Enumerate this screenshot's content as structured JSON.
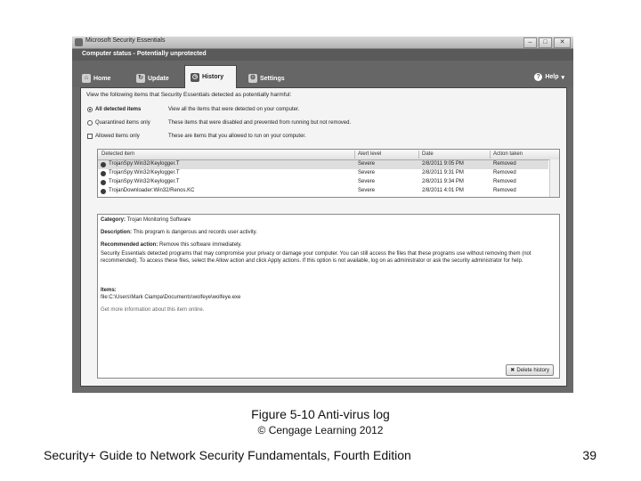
{
  "window": {
    "title": "Microsoft Security Essentials",
    "status": "Computer status - Potentially unprotected",
    "controls": {
      "minimize": "–",
      "maximize": "□",
      "close": "✕"
    }
  },
  "tabs": [
    {
      "label": "Home",
      "icon": "home-icon",
      "glyph": "⌂"
    },
    {
      "label": "Update",
      "icon": "update-icon",
      "glyph": "↻"
    },
    {
      "label": "History",
      "icon": "history-icon",
      "glyph": "◷",
      "active": true
    },
    {
      "label": "Settings",
      "icon": "gear-icon",
      "glyph": "⚙"
    }
  ],
  "help": {
    "label": "Help",
    "glyph": "?"
  },
  "history": {
    "intro": "View the following items that Security Essentials detected as potentially harmful:",
    "options": [
      {
        "label": "All detected items",
        "desc": "View all the items that were detected on your computer.",
        "selected": true
      },
      {
        "label": "Quarantined items only",
        "desc": "These items that were disabled and prevented from running but not removed.",
        "selected": false
      },
      {
        "label": "Allowed items only",
        "desc": "These are items that you allowed to run on your computer.",
        "selected": false
      }
    ],
    "columns": [
      "Detected item",
      "Alert level",
      "Date",
      "Action taken"
    ],
    "rows": [
      {
        "item": "TrojanSpy:Win32/Keylogger.T",
        "level": "Severe",
        "date": "2/8/2011 9:05 PM",
        "action": "Removed"
      },
      {
        "item": "TrojanSpy:Win32/Keylogger.T",
        "level": "Severe",
        "date": "2/8/2011 9:31 PM",
        "action": "Removed"
      },
      {
        "item": "TrojanSpy:Win32/Keylogger.T",
        "level": "Severe",
        "date": "2/8/2011 9:34 PM",
        "action": "Removed"
      },
      {
        "item": "TrojanDownloader:Win32/Renos.KC",
        "level": "Severe",
        "date": "2/8/2011 4:01 PM",
        "action": "Removed"
      }
    ],
    "details": {
      "category_label": "Category:",
      "category": "Trojan Monitoring Software",
      "description_label": "Description:",
      "description": "This program is dangerous and records user activity.",
      "recommendation_label": "Recommended action:",
      "recommendation": "Remove this software immediately.",
      "paragraph": "Security Essentials detected programs that may compromise your privacy or damage your computer. You can still access the files that these programs use without removing them (not recommended). To access these files, select the Allow action and click Apply actions. If this option is not available, log on as administrator or ask the security administrator for help.",
      "items_label": "Items:",
      "item_path": "file:C:\\Users\\Mark Ciampa\\Documents\\wolfeye\\wolfeye.exe",
      "more_link": "Get more information about this item online."
    },
    "delete_button": "Delete history"
  },
  "caption": {
    "figure": "Figure 5-10 Anti-virus log",
    "copyright": "© Cengage Learning 2012"
  },
  "footer": {
    "book_title": "Security+ Guide to Network Security Fundamentals, Fourth Edition",
    "page": "39"
  }
}
